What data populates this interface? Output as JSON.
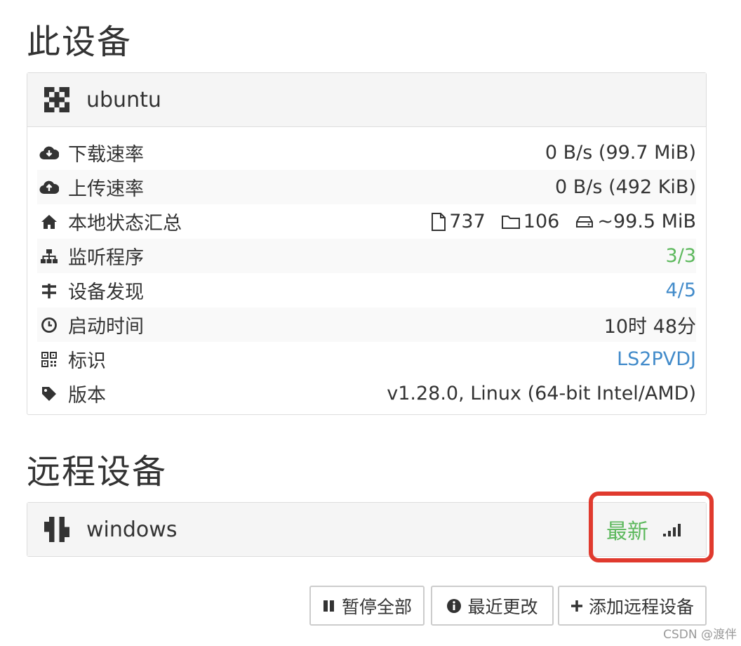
{
  "this_device": {
    "section_title": "此设备",
    "name": "ubuntu",
    "rows": [
      {
        "label": "下载速率",
        "value": "0 B/s (99.7 MiB)"
      },
      {
        "label": "上传速率",
        "value": "0 B/s (492 KiB)"
      },
      {
        "label": "本地状态汇总",
        "files": "737",
        "folders": "106",
        "size": "~99.5 MiB"
      },
      {
        "label": "监听程序",
        "value": "3/3"
      },
      {
        "label": "设备发现",
        "value": "4/5"
      },
      {
        "label": "启动时间",
        "value": "10时 48分"
      },
      {
        "label": "标识",
        "value": "LS2PVDJ"
      },
      {
        "label": "版本",
        "value": "v1.28.0, Linux (64-bit Intel/AMD)"
      }
    ]
  },
  "remote_devices": {
    "section_title": "远程设备",
    "devices": [
      {
        "name": "windows",
        "status": "最新",
        "status_icon": "signal-bars-icon"
      }
    ]
  },
  "buttons": {
    "pause_all": "暂停全部",
    "recent_changes": "最近更改",
    "add_remote": "添加远程设备"
  },
  "watermark": "CSDN @渡伴",
  "colors": {
    "green": "#5cb85c",
    "blue": "#428bca",
    "highlight": "#e03a2e"
  }
}
